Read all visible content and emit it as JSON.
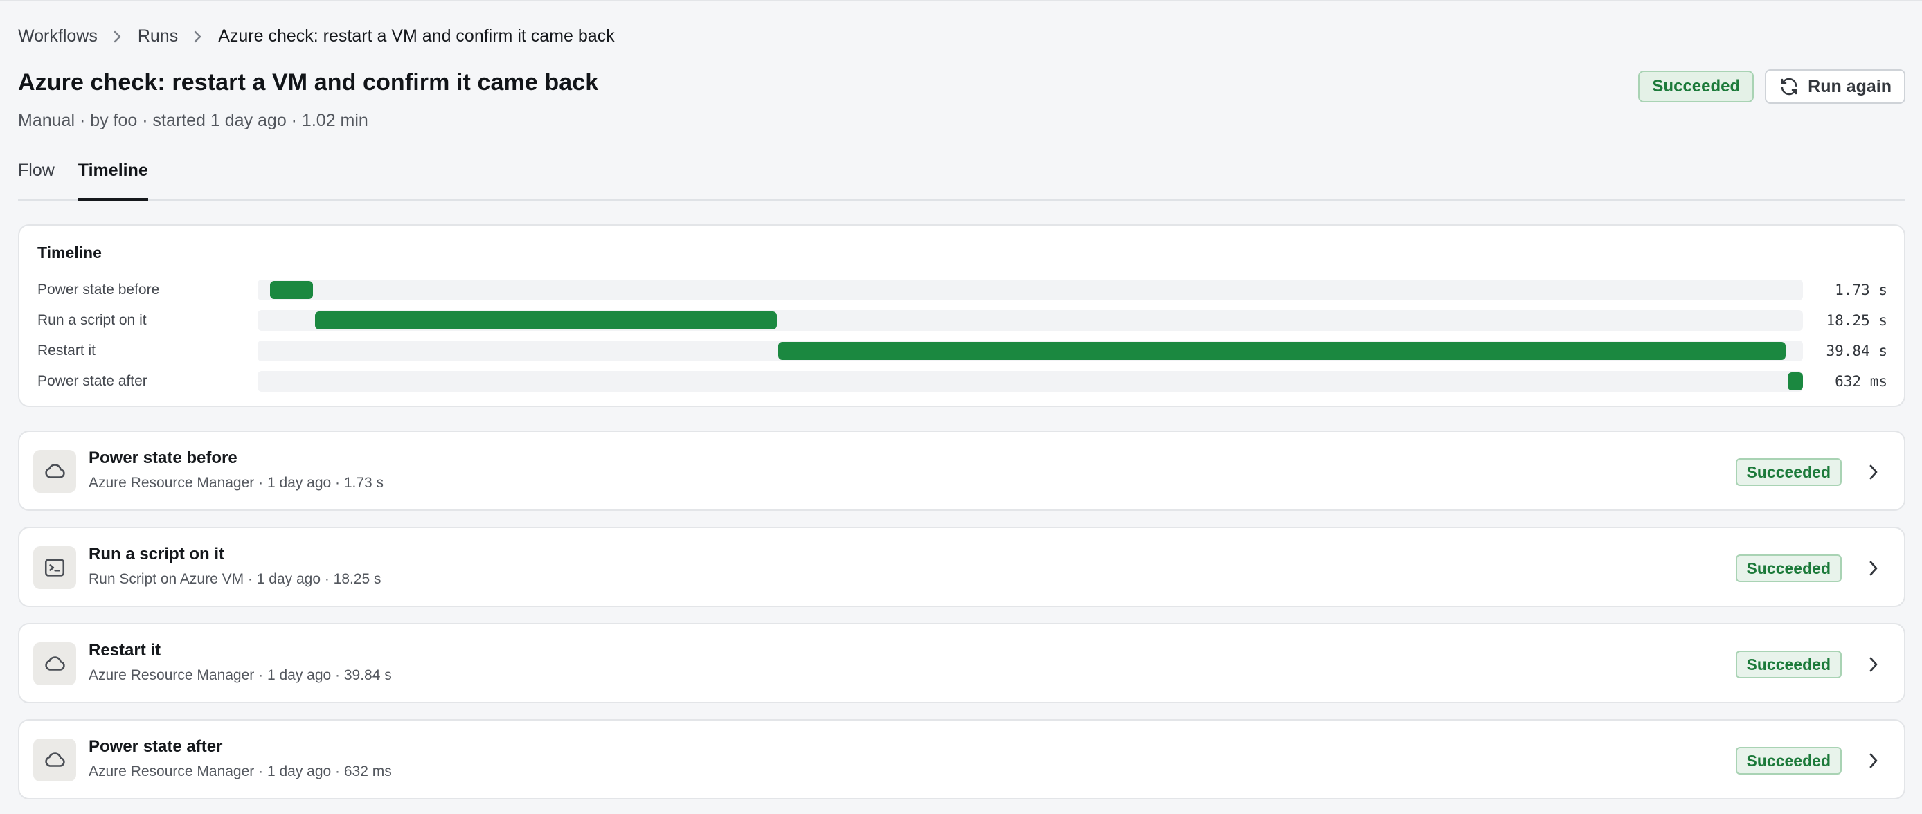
{
  "breadcrumb": {
    "items": [
      "Workflows",
      "Runs"
    ],
    "current": "Azure check: restart a VM and confirm it came back"
  },
  "header": {
    "title": "Azure check: restart a VM and confirm it came back",
    "meta": "Manual · by foo · started 1 day ago · 1.02 min",
    "status": "Succeeded",
    "run_again_label": "Run again"
  },
  "tabs": [
    {
      "label": "Flow",
      "active": false
    },
    {
      "label": "Timeline",
      "active": true
    }
  ],
  "timeline": {
    "title": "Timeline",
    "rows": [
      {
        "label": "Power state before",
        "duration": "1.73 s",
        "start_fraction": 0.008,
        "length_fraction": 0.028
      },
      {
        "label": "Run a script on it",
        "duration": "18.25 s",
        "start_fraction": 0.037,
        "length_fraction": 0.299
      },
      {
        "label": "Restart it",
        "duration": "39.84 s",
        "start_fraction": 0.337,
        "length_fraction": 0.652
      },
      {
        "label": "Power state after",
        "duration": "632 ms",
        "start_fraction": 0.99,
        "length_fraction": 0.01
      }
    ]
  },
  "steps": [
    {
      "name": "Power state before",
      "meta": "Azure Resource Manager · 1 day ago · 1.73 s",
      "status": "Succeeded",
      "icon": "cloud-icon"
    },
    {
      "name": "Run a script on it",
      "meta": "Run Script on Azure VM · 1 day ago · 18.25 s",
      "status": "Succeeded",
      "icon": "terminal-icon"
    },
    {
      "name": "Restart it",
      "meta": "Azure Resource Manager · 1 day ago · 39.84 s",
      "status": "Succeeded",
      "icon": "cloud-icon"
    },
    {
      "name": "Power state after",
      "meta": "Azure Resource Manager · 1 day ago · 632 ms",
      "status": "Succeeded",
      "icon": "cloud-icon"
    }
  ],
  "colors": {
    "success_text": "#1c7a3a",
    "success_bg": "#e4f1e7",
    "timeline_bar": "#1b8840"
  }
}
